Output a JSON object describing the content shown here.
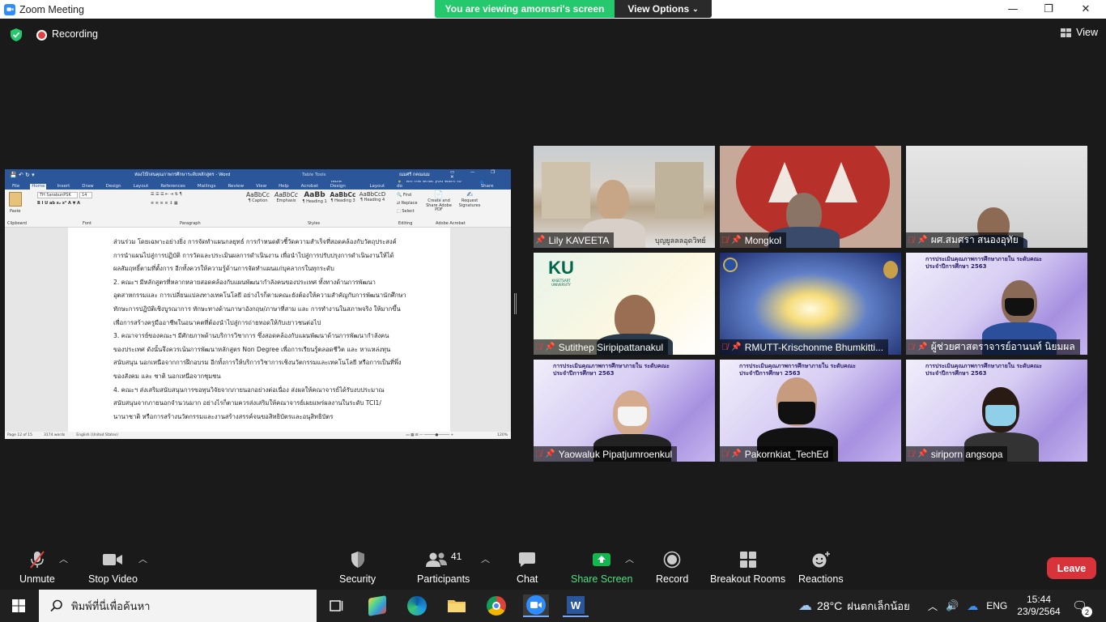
{
  "window": {
    "title": "Zoom Meeting",
    "minimize": "—",
    "restore": "❐",
    "close": "✕"
  },
  "share_banner": {
    "viewing_text": "You are viewing amornsri's screen",
    "view_options_label": "View Options"
  },
  "top_bar": {
    "recording_label": "Recording",
    "view_label": "View"
  },
  "word": {
    "title": "ห่องโบ๊กสนคุณภาพกรศึกษาระดับหลักสูตร - Word",
    "table_tools": "Table Tools",
    "user": "ณมศรี กคณณม",
    "tabs": [
      "File",
      "Home",
      "Insert",
      "Draw",
      "Design",
      "Layout",
      "References",
      "Mailings",
      "Review",
      "View",
      "Help",
      "Acrobat",
      "Table Design",
      "Layout"
    ],
    "tell_me": "Tell me what you want to do",
    "share": "Share",
    "font_name": "TH SarabunPSK",
    "font_size": "14",
    "groups": [
      "Clipboard",
      "Font",
      "Paragraph",
      "Styles",
      "Editing",
      "Adobe Acrobat"
    ],
    "styles": [
      {
        "sample": "AaBbCc",
        "name": "¶ Caption"
      },
      {
        "sample": "AaBbCc",
        "name": "Emphasis"
      },
      {
        "sample": "AaBb",
        "name": "¶ Heading 1"
      },
      {
        "sample": "AaBbCc",
        "name": "¶ Heading 3"
      },
      {
        "sample": "AaBbCcD",
        "name": "¶ Heading 4"
      }
    ],
    "editing": [
      "Find",
      "Replace",
      "Select"
    ],
    "acrobat": [
      "Create and Share Adobe PDF",
      "Request Signatures"
    ],
    "paste": "Paste",
    "lines": [
      "ส่วนร่วม โดยเฉพาะอย่างยิ่ง การจัดทำแผนกลยุทธ์ การกำหนดตัวชี้วัดความสำเร็จที่สอดคล้องกับวัตถุประสงค์",
      "การนำแผนไปสู่การปฏิบัติ การวัดและประเมินผลการดำเนินงาน เพื่อนำไปสู่การปรับปรุงการดำเนินงานให้ได้",
      "ผลสัมฤทธิ์ตามที่ตั้งการ  อีกทั้งควรให้ความรู้ด้านการจัดทำแผนแก่บุคลากรในทุกระดับ",
      "      2.   คณะฯ มีหลักสูตรที่หลากหลายสอดคล้องกับแผนพัฒนากำลังคนของประเทศ ทั้งทางด้านการพัฒนา",
      "อุตสาหกรรมและ การเปลี่ยนแปลงทางเทคโนโลยี อย่างไรก็ตามคณะยังต้องให้ความสำคัญกับการพัฒนานักศึกษา",
      "ทักษะการปฏิบัติเชิงบูรณาการ ทักษะทางด้านภาษาอังกฤษ/ภาษาที่สาม และ การทำงานในสภาพจริง ให้มากขึ้น",
      "เพื่อการสร้างครูมืออาชีพในอนาคตที่ต้องนำไปสู่การถ่ายทอดให้กับเยาวชนต่อไป",
      "      3.   คณาจารย์ของคณะฯ มีศักยภาพด้านบริการวิชาการ ซึ่งสอดคล้องกับแผนพัฒนาด้านการพัฒนากำลังคน",
      "ของประเทศ ดังนั้นจึงควรเน้นการพัฒนาหลักสูตร Non Degree เพื่อการเรียนรู้ตลอดชีวิต และ หาแหล่งทุน",
      "สนับสนุน นอกเหนือจากการฝึกอบรม อีกทั้งการให้บริการวิชาการเชิงนวัตกรรมและเทคโนโลยี หรือการเป็นที่พึ่ง",
      "ของสังคม และ ชาติ นอกเหนือจากชุมชน",
      "      4.   คณะฯ ส่งเสริมสนับสนุนการขอทุนวิจัยจากภายนอกอย่างต่อเนื่อง ส่งผลให้คณาจารย์ได้รับงบประมาณ",
      "สนับสนุนจากภายนอกจำนวนมาก อย่างไรก็ตามควรส่งเสริมให้คณาจารย์เผยแพร่ผลงานในระดับ TCI1/",
      "นานาชาติ หรือการสร้างนวัตกรรมและงานสร้างสรรค์จนขอสิทธิบัตรและอนุสิทธิบัตร"
    ],
    "status": {
      "page": "Page 12 of 15",
      "words": "3174 words",
      "language": "English (United States)",
      "zoom": "120%"
    }
  },
  "participants": [
    {
      "name": "Lily KAVEETA",
      "muted": false,
      "overlay": "บุญยูลลลอุดวิทย์"
    },
    {
      "name": "Mongkol",
      "muted": true
    },
    {
      "name": "ผศ.สมศรา  สนองอุทัย",
      "muted": true
    },
    {
      "name": "Sutithep Siripipattanakul",
      "muted": true,
      "logo_letters": "KU",
      "logo_sub": "KASETSART UNIVERSITY"
    },
    {
      "name": "RMUTT-Krischonme Bhumkitti...",
      "muted": true
    },
    {
      "name": "ผู้ช่วยศาสตราจารย์อานนท์ นิยมผล",
      "muted": true,
      "banner": "การประเมินคุณภาพการศึกษาภายใน ระดับคณะ ประจำปีการศึกษา 2563"
    },
    {
      "name": "Yaowaluk Pipatjumroenkul",
      "muted": true,
      "banner": "การประเมินคุณภาพการศึกษาภายใน ระดับคณะ ประจำปีการศึกษา 2563"
    },
    {
      "name": "Pakornkiat_TechEd",
      "muted": true,
      "banner": "การประเมินคุณภาพการศึกษาภายใน ระดับคณะ ประจำปีการศึกษา 2563"
    },
    {
      "name": "siriporn angsopa",
      "muted": true,
      "banner": "การประเมินคุณภาพการศึกษาภายใน ระดับคณะ ประจำปีการศึกษา 2563"
    }
  ],
  "toolbar": {
    "unmute": "Unmute",
    "stop_video": "Stop Video",
    "security": "Security",
    "participants": "Participants",
    "participant_count": "41",
    "chat": "Chat",
    "share_screen": "Share Screen",
    "record": "Record",
    "breakout_rooms": "Breakout Rooms",
    "reactions": "Reactions",
    "leave": "Leave"
  },
  "taskbar": {
    "search_placeholder": "พิมพ์ที่นี่เพื่อค้นหา",
    "temperature": "28°C",
    "weather": "ฝนตกเล็กน้อย",
    "language": "ENG",
    "time": "15:44",
    "date": "23/9/2564",
    "notifications": "2"
  },
  "colors": {
    "zoom_blue": "#2d8cff",
    "banner_green": "#23c96c",
    "leave_red": "#d8323a",
    "word_blue": "#2b579a",
    "share_green": "#12b84e"
  }
}
